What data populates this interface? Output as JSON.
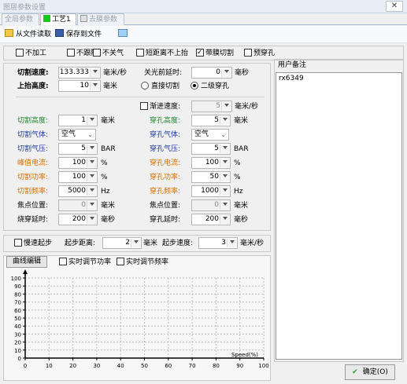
{
  "window": {
    "title": "图层参数设置",
    "close_glyph": "✕"
  },
  "tabs": [
    {
      "label": "全局参数",
      "active": false
    },
    {
      "label": "工艺1",
      "active": true,
      "color": "#17c81a"
    },
    {
      "label": "去膜参数",
      "active": false
    }
  ],
  "toolbar": {
    "read_from_file": "从文件读取",
    "save_to_file": "保存到文件"
  },
  "options": [
    {
      "label": "不加工",
      "checked": false
    },
    {
      "label": "不跟随",
      "checked": false
    },
    {
      "label": "不关气",
      "checked": false
    },
    {
      "label": "短距离不上抬",
      "checked": false
    },
    {
      "label": "带膜切割",
      "checked": true
    },
    {
      "label": "预穿孔",
      "checked": false
    }
  ],
  "main": {
    "cut_speed": {
      "label": "切割速度:",
      "value": "133.333",
      "unit": "毫米/秒"
    },
    "lift_height": {
      "label": "上抬高度:",
      "value": "10",
      "unit": "毫米"
    },
    "light_off_delay": {
      "label": "关光前延时:",
      "value": "0",
      "unit": "毫秒"
    },
    "radio_direct": "直接切割",
    "radio_two_stage": "二级穿孔",
    "gradual_speed": {
      "label": "渐进速度:",
      "value": "5",
      "unit": "毫米/秒"
    }
  },
  "params_left": [
    {
      "label": "切割高度:",
      "kind": "spin",
      "value": "1",
      "unit": "毫米",
      "color": "green"
    },
    {
      "label": "切割气体:",
      "kind": "select",
      "value": "空气",
      "unit": "",
      "color": "blue"
    },
    {
      "label": "切割气压:",
      "kind": "spin",
      "value": "5",
      "unit": "BAR",
      "color": "blue"
    },
    {
      "label": "峰值电流:",
      "kind": "spin",
      "value": "100",
      "unit": "%",
      "color": "orange"
    },
    {
      "label": "切割功率:",
      "kind": "spin",
      "value": "100",
      "unit": "%",
      "color": "orange"
    },
    {
      "label": "切割频率:",
      "kind": "spin",
      "value": "5000",
      "unit": "Hz",
      "color": "orange"
    },
    {
      "label": "焦点位置:",
      "kind": "spin",
      "value": "0",
      "unit": "毫米",
      "color": "black",
      "disabled": true
    },
    {
      "label": "烧穿延时:",
      "kind": "spin",
      "value": "200",
      "unit": "毫秒",
      "color": "black"
    }
  ],
  "params_right": [
    {
      "label": "穿孔高度:",
      "kind": "spin",
      "value": "5",
      "unit": "毫米",
      "color": "green"
    },
    {
      "label": "穿孔气体:",
      "kind": "select",
      "value": "空气",
      "unit": "",
      "color": "blue"
    },
    {
      "label": "穿孔气压:",
      "kind": "spin",
      "value": "5",
      "unit": "BAR",
      "color": "blue"
    },
    {
      "label": "穿孔电流:",
      "kind": "spin",
      "value": "100",
      "unit": "%",
      "color": "orange"
    },
    {
      "label": "穿孔功率:",
      "kind": "spin",
      "value": "50",
      "unit": "%",
      "color": "orange"
    },
    {
      "label": "穿孔频率:",
      "kind": "spin",
      "value": "1000",
      "unit": "Hz",
      "color": "orange"
    },
    {
      "label": "焦点位置:",
      "kind": "spin",
      "value": "0",
      "unit": "毫米",
      "color": "black",
      "disabled": true
    },
    {
      "label": "穿孔延时:",
      "kind": "spin",
      "value": "200",
      "unit": "毫秒",
      "color": "black"
    }
  ],
  "slow_start": {
    "label": "慢速起步",
    "distance_label": "起步距离:",
    "distance_value": "2",
    "distance_unit": "毫米",
    "speed_label": "起步速度:",
    "speed_value": "3",
    "speed_unit": "毫米/秒"
  },
  "curve": {
    "button": "曲线编辑",
    "realtime_power": "实时调节功率",
    "realtime_freq": "实时调节频率"
  },
  "chart_data": {
    "type": "line",
    "title": "",
    "xlabel": "Speed(%)",
    "ylabel": "",
    "xlim": [
      0,
      100
    ],
    "ylim": [
      0,
      100
    ],
    "xticks": [
      0,
      10,
      20,
      30,
      40,
      50,
      60,
      70,
      80,
      90,
      100
    ],
    "yticks": [
      0,
      10,
      20,
      30,
      40,
      50,
      60,
      70,
      80,
      90,
      100
    ],
    "grid": true,
    "series": []
  },
  "notes": {
    "title": "用户备注",
    "text": "rx6349"
  },
  "ok_button": "确定(O)"
}
